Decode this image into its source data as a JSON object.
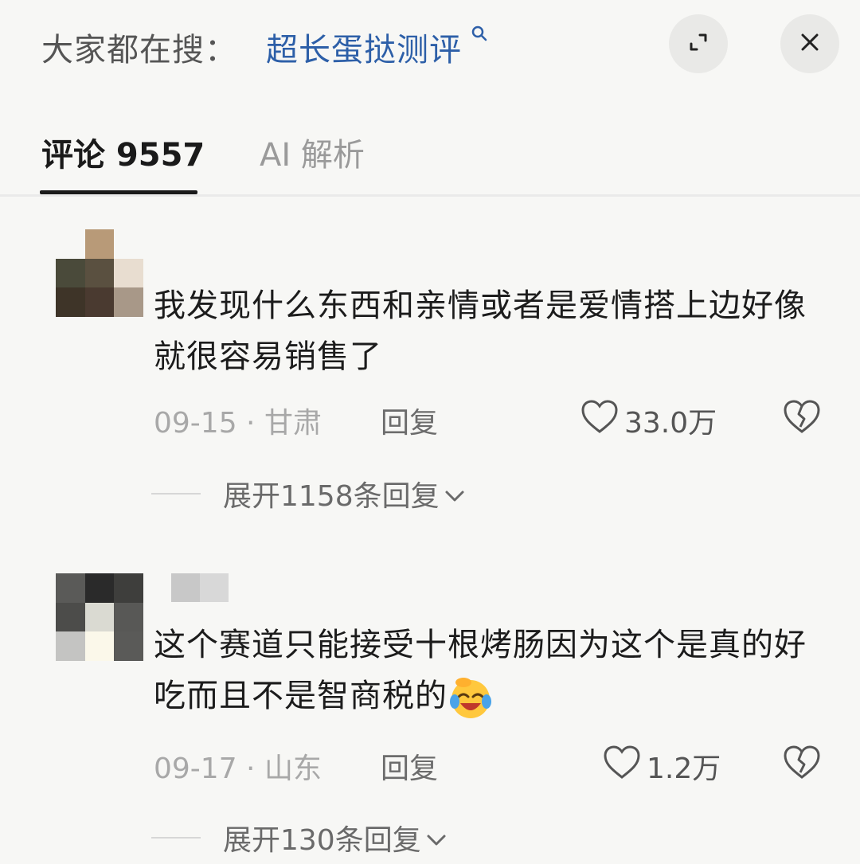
{
  "header": {
    "search_prefix": "大家都在搜：",
    "search_query": "超长蛋挞测评",
    "search_icon": "search-icon",
    "expand_icon": "expand-icon",
    "close_icon": "close-icon"
  },
  "tabs": [
    {
      "label": "评论 9557",
      "active": true
    },
    {
      "label": "AI 解析",
      "active": false
    }
  ],
  "comments": [
    {
      "text": "我发现什么东西和亲情或者是爱情搭上边好像就很容易销售了",
      "meta": "09-15 · 甘肃",
      "reply_label": "回复",
      "likes": "33.0万",
      "expand_label": "展开1158条回复"
    },
    {
      "text": "这个赛道只能接受十根烤肠因为这个是真的好吃而且不是智商税的",
      "emoji": "laughing-crying-emoji",
      "meta": "09-17 · 山东",
      "reply_label": "回复",
      "likes": "1.2万",
      "expand_label": "展开130条回复"
    }
  ],
  "colors": {
    "background": "#f7f7f5",
    "link": "#2d5fa8",
    "active_tab": "#1a1a1a",
    "muted": "#a8a8a8"
  }
}
